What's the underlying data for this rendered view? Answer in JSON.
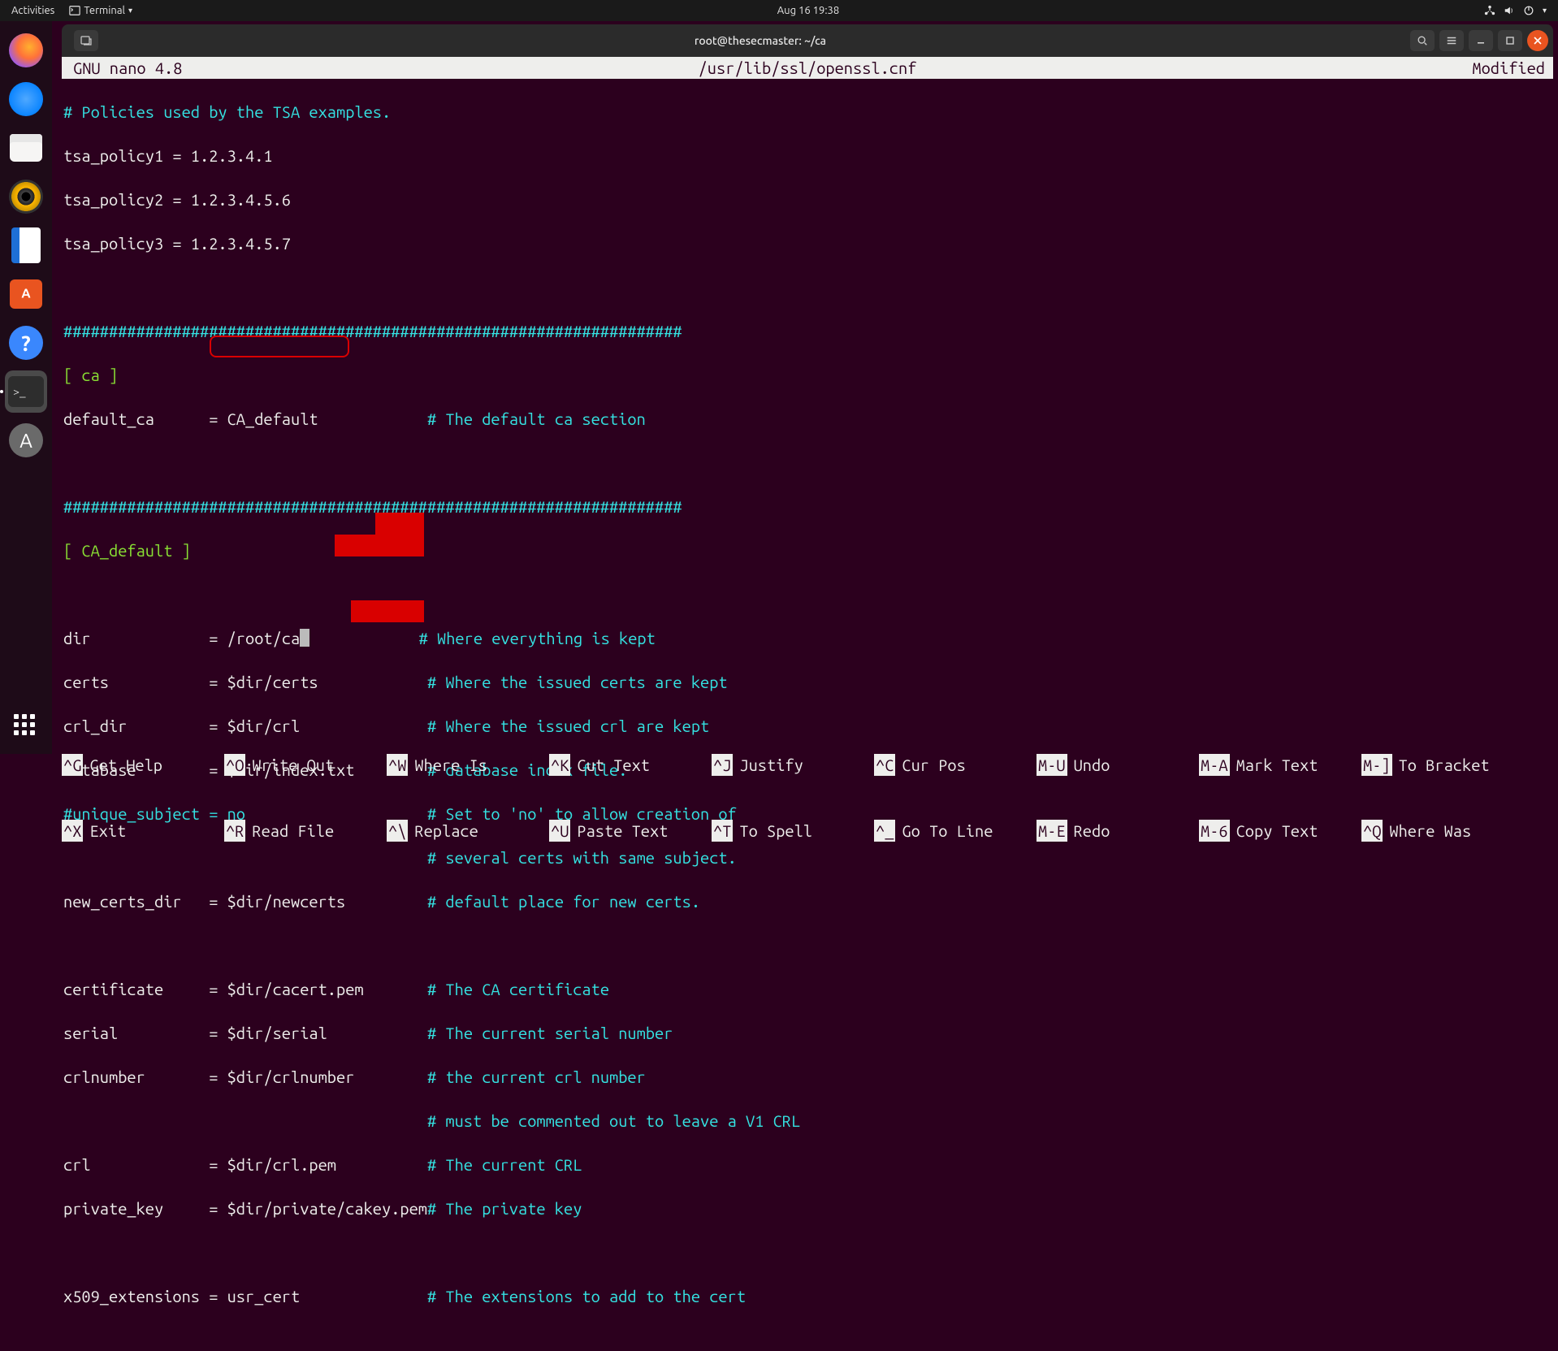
{
  "gnome": {
    "activities": "Activities",
    "terminal_menu": "Terminal",
    "clock": "Aug 16  19:38"
  },
  "window": {
    "title": "root@thesecmaster: ~/ca"
  },
  "nano": {
    "version": "GNU nano 4.8",
    "file": "/usr/lib/ssl/openssl.cnf",
    "modified": "Modified",
    "shortcuts_row1": [
      {
        "key": "^G",
        "label": "Get Help"
      },
      {
        "key": "^O",
        "label": "Write Out"
      },
      {
        "key": "^W",
        "label": "Where Is"
      },
      {
        "key": "^K",
        "label": "Cut Text"
      },
      {
        "key": "^J",
        "label": "Justify"
      },
      {
        "key": "^C",
        "label": "Cur Pos"
      },
      {
        "key": "M-U",
        "label": "Undo"
      },
      {
        "key": "M-A",
        "label": "Mark Text"
      },
      {
        "key": "M-]",
        "label": "To Bracket"
      }
    ],
    "shortcuts_row2": [
      {
        "key": "^X",
        "label": "Exit"
      },
      {
        "key": "^R",
        "label": "Read File"
      },
      {
        "key": "^\\",
        "label": "Replace"
      },
      {
        "key": "^U",
        "label": "Paste Text"
      },
      {
        "key": "^T",
        "label": "To Spell"
      },
      {
        "key": "^_",
        "label": "Go To Line"
      },
      {
        "key": "M-E",
        "label": "Redo"
      },
      {
        "key": "M-6",
        "label": "Copy Text"
      },
      {
        "key": "^Q",
        "label": "Where Was"
      }
    ]
  },
  "lines": {
    "l1_comment": "# Policies used by the TSA examples.",
    "l2": "tsa_policy1 = 1.2.3.4.1",
    "l3": "tsa_policy2 = 1.2.3.4.5.6",
    "l4": "tsa_policy3 = 1.2.3.4.5.7",
    "hr": "####################################################################",
    "sec_ca": "[ ca ]",
    "default_ca_left": "default_ca      = CA_default",
    "default_ca_right": "# The default ca section",
    "sec_ca_default": "[ CA_default ]",
    "dir_key": "dir",
    "dir_eq": "= /root/ca",
    "dir_com": "# Where everything is kept",
    "certs_left": "certs           = $dir/certs",
    "certs_com": "# Where the issued certs are kept",
    "crl_dir_left": "crl_dir         = $dir/crl",
    "crl_dir_com": "# Where the issued crl are kept",
    "database_left": "database        = $dir/index.txt",
    "database_com": "# database index file.",
    "uniq_left": "#unique_subject = no",
    "uniq_com1": "# Set to 'no' to allow creation of",
    "uniq_com2": "# several certs with same subject.",
    "newcerts_left": "new_certs_dir   = $dir/newcerts",
    "newcerts_com": "# default place for new certs.",
    "cert_left": "certificate     = $dir/cacert.pem",
    "cert_com": "# The CA certificate",
    "serial_left": "serial          = $dir/serial",
    "serial_com": "# The current serial number",
    "crlnum_left": "crlnumber       = $dir/crlnumber",
    "crlnum_com": "# the current crl number",
    "crl_note": "# must be commented out to leave a V1 CRL",
    "crl_left": "crl             = $dir/crl.pem",
    "crl_com": "# The current CRL",
    "pkey_left": "private_key     = $dir/private/cakey.pem",
    "pkey_com": "# The private key",
    "x509_left": "x509_extensions = usr_cert",
    "x509_com": "# The extensions to add to the cert"
  }
}
